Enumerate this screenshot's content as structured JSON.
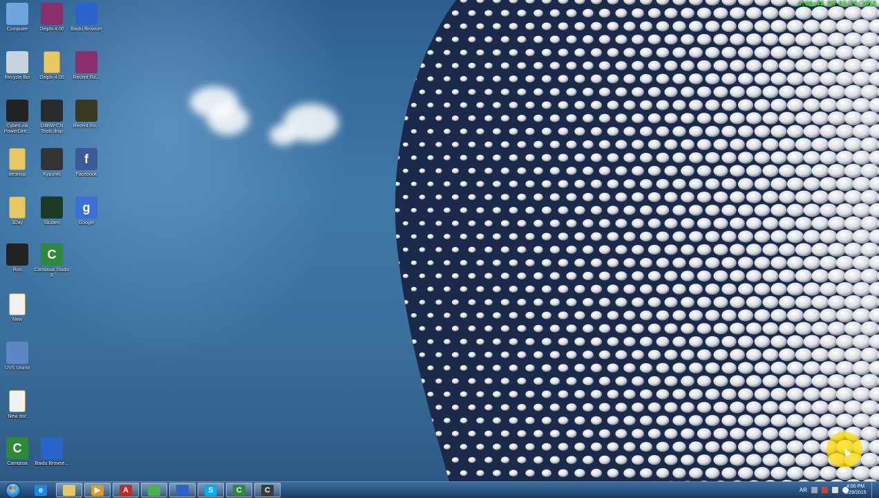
{
  "recording_overlay": {
    "clock_text": "4:00:48 PM 03/29/2015"
  },
  "desktop": {
    "icons": [
      {
        "id": "computer",
        "label": "Computer",
        "icon": "computer-icon",
        "color": "#6fa6e0"
      },
      {
        "id": "delphi1",
        "label": "Delphi 4.00",
        "icon": "archive-icon",
        "color": "#8b2e6e"
      },
      {
        "id": "baidu",
        "label": "Baidu Browser",
        "icon": "browser-icon",
        "color": "#2a63c9"
      },
      {
        "id": "recycle",
        "label": "Recycle Bin",
        "icon": "recycle-bin-icon",
        "color": "#c9d3dc"
      },
      {
        "id": "delphi2",
        "label": "Delphi 4.00",
        "icon": "folder-icon",
        "color": "#e8c765"
      },
      {
        "id": "rar1",
        "label": "Recent Ro...",
        "icon": "archive-icon",
        "color": "#8b2e6e"
      },
      {
        "id": "cyberlink",
        "label": "CyberLink PowerDire...",
        "icon": "cyberlink-icon",
        "color": "#222222"
      },
      {
        "id": "dwn",
        "label": "D4BW-CN Tools.dmp",
        "icon": "lightning-icon",
        "color": "#2a2a2a"
      },
      {
        "id": "rec2",
        "label": "Recent Ro...",
        "icon": "document-icon",
        "color": "#3a3a22"
      },
      {
        "id": "desktop",
        "label": "desktop",
        "icon": "folder-icon",
        "color": "#e8c765"
      },
      {
        "id": "kypunkt",
        "label": "Kypunkt",
        "icon": "graduate-icon",
        "color": "#333333"
      },
      {
        "id": "facebook",
        "label": "Facebook",
        "icon": "facebook-icon",
        "color": "#3b5998"
      },
      {
        "id": "3day",
        "label": "3Day",
        "icon": "folder-icon",
        "color": "#e8c765"
      },
      {
        "id": "studies",
        "label": "Studies",
        "icon": "app-icon",
        "color": "#1d3a24"
      },
      {
        "id": "google",
        "label": "Google",
        "icon": "google-icon",
        "color": "#3a6fd8"
      },
      {
        "id": "run",
        "label": "Run",
        "icon": "run-icon",
        "color": "#222222"
      },
      {
        "id": "camtasia1",
        "label": "Camtasia Studio 8",
        "icon": "camtasia-icon",
        "color": "#2e8a3a"
      },
      {
        "id": "new",
        "label": "New",
        "icon": "file-icon",
        "color": "#f1f1f1"
      },
      {
        "id": "uvs",
        "label": "UVS Uninst",
        "icon": "installer-icon",
        "color": "#5c86c6"
      },
      {
        "id": "newdoc",
        "label": "New doc",
        "icon": "text-file-icon",
        "color": "#f1f1f1"
      },
      {
        "id": "camtasia2",
        "label": "Camtasia",
        "icon": "camtasia-icon",
        "color": "#2e8a3a"
      },
      {
        "id": "baidu2",
        "label": "Baidu Browse...",
        "icon": "browser-icon",
        "color": "#2a63c9"
      }
    ]
  },
  "taskbar": {
    "start_label": "Start",
    "pinned": [
      {
        "id": "ie",
        "icon": "ie-icon",
        "glyph": "e",
        "color": "#1e88e5",
        "active": false
      },
      {
        "id": "explorer",
        "icon": "folder-icon",
        "glyph": "",
        "color": "#e8c765",
        "active": true
      },
      {
        "id": "media",
        "icon": "media-player-icon",
        "glyph": "▶",
        "color": "#e09a1a",
        "active": true
      },
      {
        "id": "pdf",
        "icon": "pdf-icon",
        "glyph": "A",
        "color": "#c62828",
        "active": true
      },
      {
        "id": "chrome",
        "icon": "chrome-icon",
        "glyph": "",
        "color": "#4caf50",
        "active": true
      },
      {
        "id": "baidu",
        "icon": "browser-icon",
        "glyph": "",
        "color": "#2a63c9",
        "active": true
      },
      {
        "id": "skype",
        "icon": "skype-icon",
        "glyph": "S",
        "color": "#00aff0",
        "active": true
      },
      {
        "id": "camtasia",
        "icon": "camtasia-icon",
        "glyph": "C",
        "color": "#2e8a3a",
        "active": true
      },
      {
        "id": "camrec",
        "icon": "camtasia-recorder-icon",
        "glyph": "C",
        "color": "#3a3a3a",
        "active": true
      }
    ],
    "tray": {
      "language": "AR"
    },
    "clock": {
      "time": "4:00 PM",
      "date": "3/29/2015"
    }
  }
}
